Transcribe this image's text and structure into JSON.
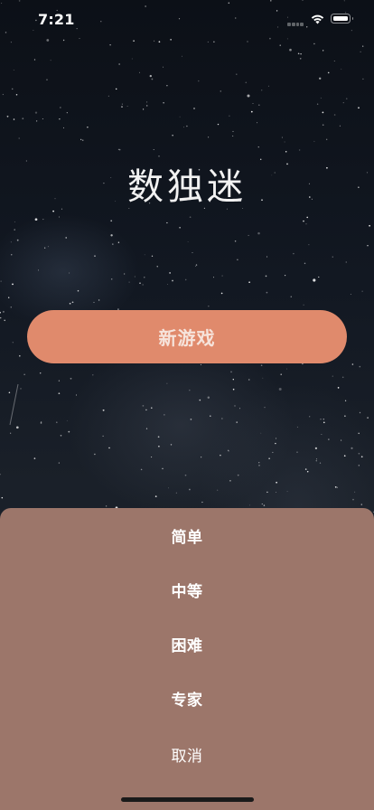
{
  "status_bar": {
    "time": "7:21",
    "icons": [
      "cellular-icon",
      "wifi-icon",
      "battery-icon"
    ]
  },
  "main": {
    "title": "数独迷",
    "new_game_label": "新游戏"
  },
  "difficulty_sheet": {
    "options": [
      "简单",
      "中等",
      "困难",
      "专家"
    ],
    "cancel_label": "取消"
  },
  "colors": {
    "button": "#e08a6c",
    "sheet": "#9c766a",
    "text": "#ffffff"
  }
}
